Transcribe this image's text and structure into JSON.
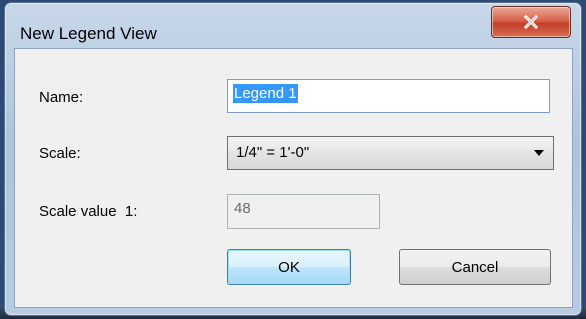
{
  "dialog": {
    "title": "New Legend View",
    "close_icon": "close-x-icon"
  },
  "form": {
    "name_label": "Name:",
    "name_value": "Legend 1",
    "scale_label": "Scale:",
    "scale_value_selected": "1/4\" = 1'-0\"",
    "scale_value_label": "Scale value  1:",
    "scale_value": "48"
  },
  "buttons": {
    "ok_label": "OK",
    "cancel_label": "Cancel"
  },
  "colors": {
    "close_button": "#c1402a",
    "selection": "#3399ff",
    "default_button_border": "#3c7fb1"
  }
}
